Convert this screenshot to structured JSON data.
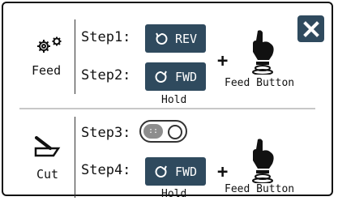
{
  "feed": {
    "section_label": "Feed",
    "step1_label": "Step1:",
    "step1_button": "REV",
    "step2_label": "Step2:",
    "step2_button": "FWD",
    "hold_label": "Hold",
    "physical_button_label": "Feed Button",
    "plus": "+"
  },
  "cut": {
    "section_label": "Cut",
    "step3_label": "Step3:",
    "toggle_knob_glyph": "::",
    "step4_label": "Step4:",
    "step4_button": "FWD",
    "hold_label": "Hold",
    "physical_button_label": "Feed Button",
    "plus": "+"
  },
  "colors": {
    "button_bg": "#2f4a5e",
    "toggle_knob": "#8d8d8d",
    "divider": "#c7c7c7"
  },
  "icons": {
    "feed": "gears-icon",
    "cut": "cutter-icon",
    "rev": "rotate-ccw-icon",
    "fwd": "rotate-cw-icon",
    "hand": "hand-press-button-icon",
    "close": "close-icon"
  }
}
